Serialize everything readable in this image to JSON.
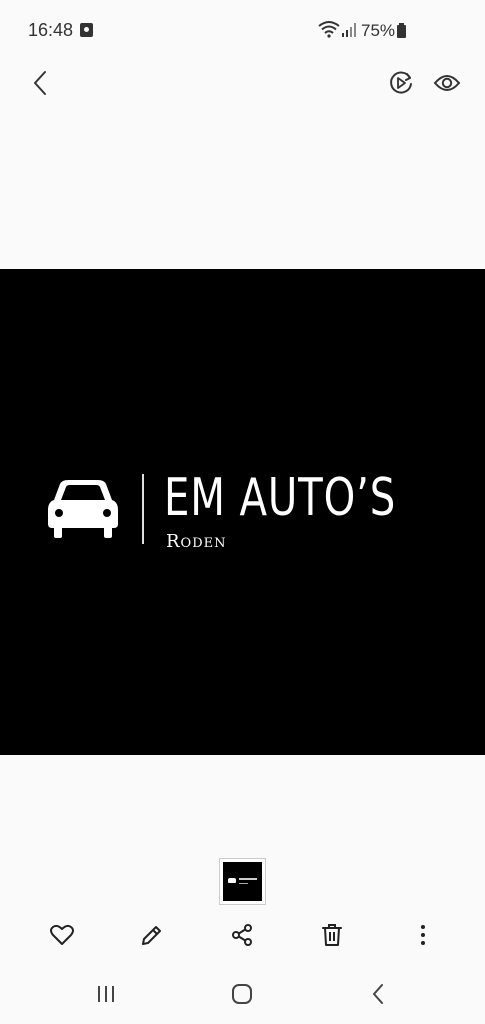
{
  "status_bar": {
    "time": "16:48",
    "battery": "75%"
  },
  "toolbar": {
    "back_icon": "chevron-left-icon",
    "motion_photo_icon": "motion-photo-icon",
    "view_icon": "eye-icon"
  },
  "photo": {
    "logo_title": "EM AUTO’S",
    "logo_subtitle": "Roden",
    "logo_icon": "car-icon",
    "background": "#000000"
  },
  "actions": {
    "favorite_icon": "heart-icon",
    "edit_icon": "pencil-icon",
    "share_icon": "share-icon",
    "delete_icon": "trash-icon",
    "more_icon": "more-vertical-icon"
  },
  "nav": {
    "recents_icon": "recents-icon",
    "home_icon": "home-icon",
    "back_icon": "back-icon"
  }
}
